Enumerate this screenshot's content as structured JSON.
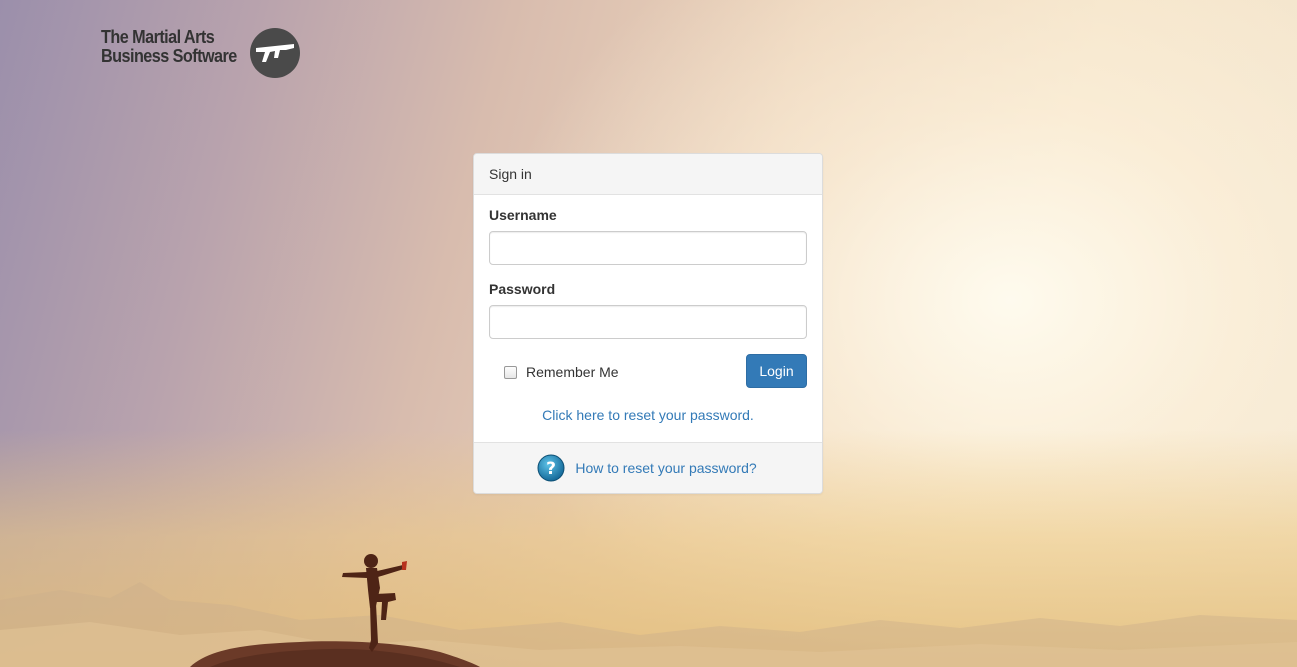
{
  "brand": {
    "line1": "The Martial Arts",
    "line2": "Business Software",
    "emblem_icon": "martial-arts-emblem-icon"
  },
  "signin": {
    "title": "Sign in",
    "username_label": "Username",
    "username_value": "",
    "password_label": "Password",
    "password_value": "",
    "remember_label": "Remember Me",
    "remember_checked": false,
    "login_label": "Login",
    "reset_link": "Click here to reset your password.",
    "help_link": "How to reset your password?",
    "help_icon": "question-help-icon"
  },
  "colors": {
    "primary": "#337ab7",
    "panel_header": "#f5f5f5"
  }
}
